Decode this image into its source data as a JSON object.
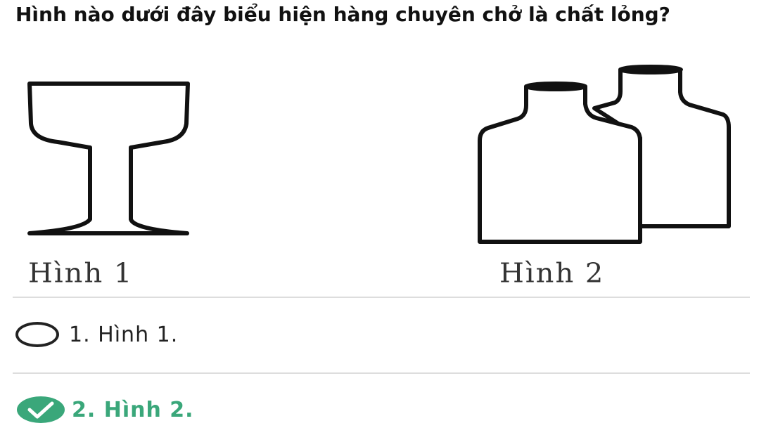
{
  "question": {
    "text": "Hình nào dưới đây biểu hiện hàng chuyên chở là chất lỏng?"
  },
  "figures": [
    {
      "icon": "wine-glass-icon",
      "caption": "Hình 1"
    },
    {
      "icon": "bottles-icon",
      "caption": "Hình 2"
    }
  ],
  "options": [
    {
      "label": "1. Hình 1.",
      "selected": false,
      "correct": false
    },
    {
      "label": "2. Hình 2.",
      "selected": true,
      "correct": true
    }
  ],
  "colors": {
    "correct": "#3aa77a",
    "text": "#111111",
    "divider": "#dddddd"
  }
}
